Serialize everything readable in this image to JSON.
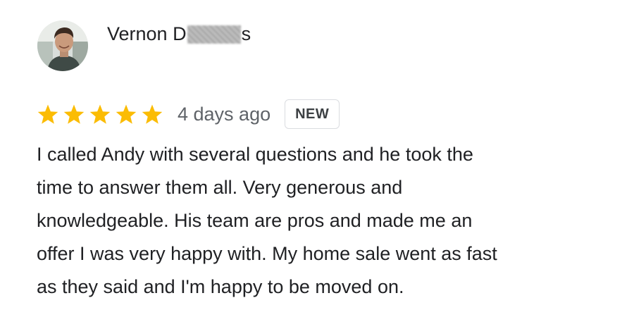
{
  "reviewer": {
    "name_prefix": "Vernon D",
    "name_suffix": "s",
    "avatar_icon": "person-photo-avatar"
  },
  "rating": {
    "stars": 5,
    "max_stars": 5,
    "star_color": "#fbbc04",
    "date": "4 days ago",
    "badge": "NEW"
  },
  "review": {
    "lines": [
      "I called Andy with several questions and he took the",
      "time to answer them all. Very generous and",
      "knowledgeable. His team are pros and made me an",
      "offer I was very happy with. My home sale went as fast",
      "as they said and I'm happy to be moved on."
    ]
  }
}
